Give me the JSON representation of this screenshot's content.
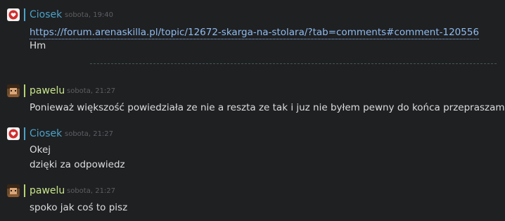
{
  "colors": {
    "background": "#1f2022",
    "ciosek_name": "#4aa3c9",
    "ciosek_bar": "#4aa3c9",
    "pawelu_name": "#c7e68a",
    "pawelu_bar": "#b5d46e",
    "timestamp": "#5d5f63",
    "link": "#8fbcf0",
    "message_text": "#dcddde"
  },
  "messages": [
    {
      "author": "Ciosek",
      "avatar_icon": "heart-badge-icon",
      "time": "sobota, 19:40",
      "lines": [
        "https://forum.arenaskilla.pl/topic/12672-skarga-na-stolara/?tab=comments#comment-120556",
        "Hm"
      ]
    },
    {
      "author": "pawelu",
      "avatar_icon": "character-portrait-icon",
      "time": "sobota, 21:27",
      "lines": [
        "Ponieważ większość powiedziała ze nie a reszta ze tak i juz nie byłem pewny do końca przepraszam"
      ]
    },
    {
      "author": "Ciosek",
      "avatar_icon": "heart-badge-icon",
      "time": "sobota, 21:27",
      "lines": [
        "Okej",
        "dzięki za odpowiedz"
      ]
    },
    {
      "author": "pawelu",
      "avatar_icon": "character-portrait-icon",
      "time": "sobota, 21:27",
      "lines": [
        "spoko jak coś to pisz"
      ]
    }
  ]
}
